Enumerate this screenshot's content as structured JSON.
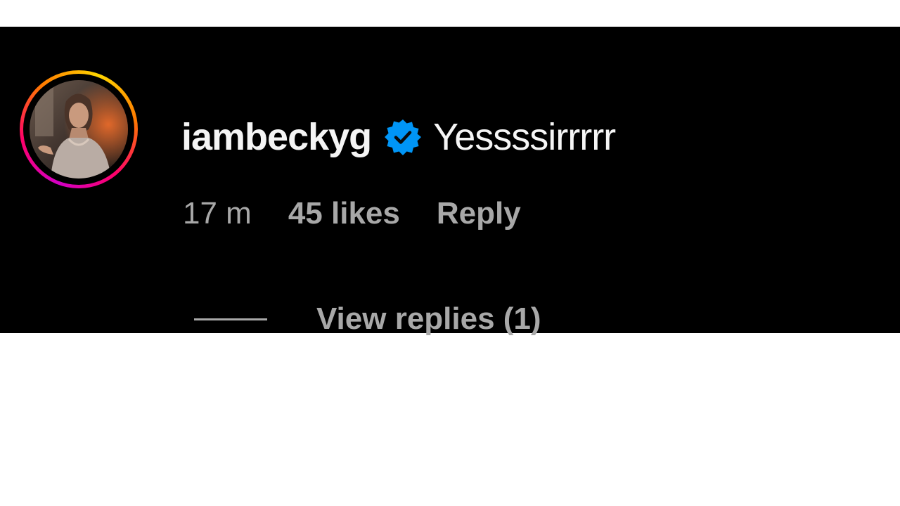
{
  "comment": {
    "username": "iambeckyg",
    "verified_icon": "verified-badge-icon",
    "text": "Yessssirrrrr",
    "time": "17 m",
    "likes": "45 likes",
    "reply_label": "Reply",
    "view_replies_label": "View replies (1)"
  },
  "colors": {
    "card_background": "#000000",
    "page_background": "#ffffff",
    "primary_text": "#f5f5f5",
    "secondary_text": "#a8a8a8",
    "verified_blue": "#0095f6"
  }
}
